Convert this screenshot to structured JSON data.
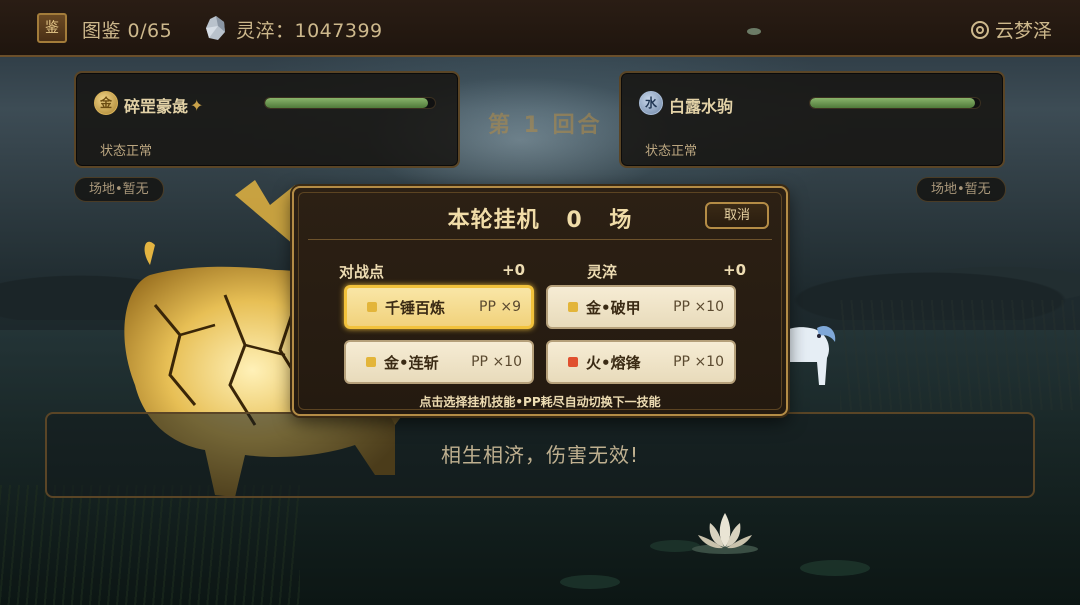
{
  "topbar": {
    "collection_icon": "鉴",
    "collection": "图鉴 0/65",
    "essence": "灵淬：1047399",
    "location": "云梦泽"
  },
  "battle": {
    "round": "第 1 回合",
    "left": {
      "element": "金",
      "name": "碎罡豪彘",
      "hp": 0.96,
      "status": "状态正常",
      "field": "场地•暂无"
    },
    "right": {
      "element": "水",
      "name": "白露水驹",
      "hp": 0.97,
      "status": "状态正常",
      "field": "场地•暂无"
    },
    "message": "相生相济，伤害无效!"
  },
  "dialog": {
    "title_prefix": "本轮挂机",
    "count": "0",
    "title_suffix": "场",
    "cancel": "取消",
    "battle_points_label": "对战点",
    "battle_points_value": "+0",
    "essence_label": "灵淬",
    "essence_value": "+0",
    "skills": [
      {
        "name": "千锤百炼",
        "pp": "PP ×9",
        "color": "#e3b53a",
        "selected": true
      },
      {
        "name": "金•破甲",
        "pp": "PP ×10",
        "color": "#e3b53a",
        "selected": false
      },
      {
        "name": "金•连斩",
        "pp": "PP ×10",
        "color": "#e3b53a",
        "selected": false
      },
      {
        "name": "火•熔锋",
        "pp": "PP ×10",
        "color": "#e0502f",
        "selected": false
      }
    ],
    "hint": "点击选择挂机技能•PP耗尽自动切换下一技能"
  }
}
